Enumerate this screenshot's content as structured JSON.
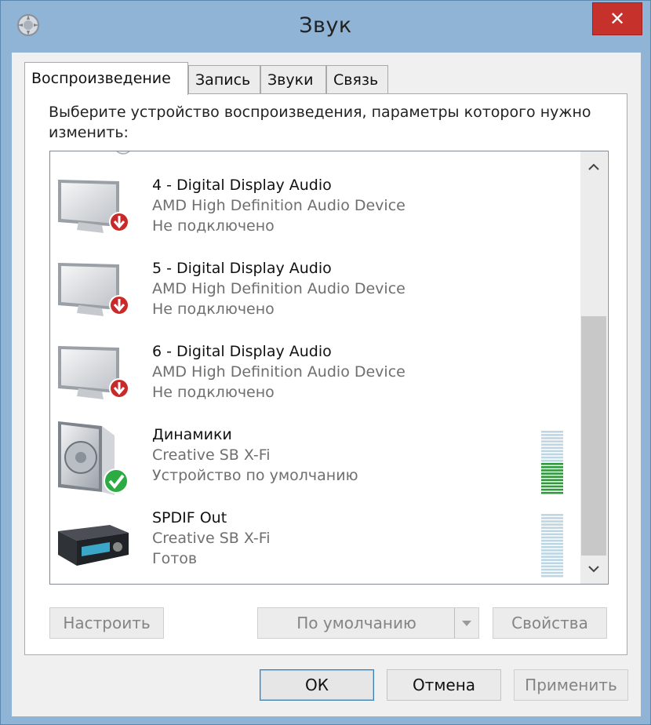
{
  "window": {
    "title": "Звук",
    "close_glyph": "✕"
  },
  "tabs": [
    {
      "label": "Воспроизведение",
      "active": true
    },
    {
      "label": "Запись",
      "active": false
    },
    {
      "label": "Звуки",
      "active": false
    },
    {
      "label": "Связь",
      "active": false
    }
  ],
  "instruction": "Выберите устройство воспроизведения, параметры которого нужно изменить:",
  "devices": [
    {
      "name": "4 - Digital Display Audio",
      "driver": "AMD High Definition Audio Device",
      "status": "Не подключено",
      "icon": "monitor-icon",
      "badge": "disconnected-badge-icon"
    },
    {
      "name": "5 - Digital Display Audio",
      "driver": "AMD High Definition Audio Device",
      "status": "Не подключено",
      "icon": "monitor-icon",
      "badge": "disconnected-badge-icon"
    },
    {
      "name": "6 - Digital Display Audio",
      "driver": "AMD High Definition Audio Device",
      "status": "Не подключено",
      "icon": "monitor-icon",
      "badge": "disconnected-badge-icon"
    },
    {
      "name": "Динамики",
      "driver": "Creative SB X-Fi",
      "status": "Устройство по умолчанию",
      "icon": "speaker-icon",
      "badge": "default-checkmark-icon",
      "volume_level": 0.5
    },
    {
      "name": "SPDIF Out",
      "driver": "Creative SB X-Fi",
      "status": "Готов",
      "icon": "receiver-icon",
      "volume_level": 0
    }
  ],
  "buttons": {
    "configure": "Настроить",
    "set_default": "По умолчанию",
    "properties": "Свойства",
    "ok": "ОК",
    "cancel": "Отмена",
    "apply": "Применить"
  },
  "colors": {
    "window_frame": "#8fb4d6",
    "close_button": "#c7312b",
    "meter_active": "#2e9a3a",
    "meter_inactive": "#bcd6e4",
    "disconnected_badge": "#c82a2a",
    "default_check": "#2bab42"
  }
}
